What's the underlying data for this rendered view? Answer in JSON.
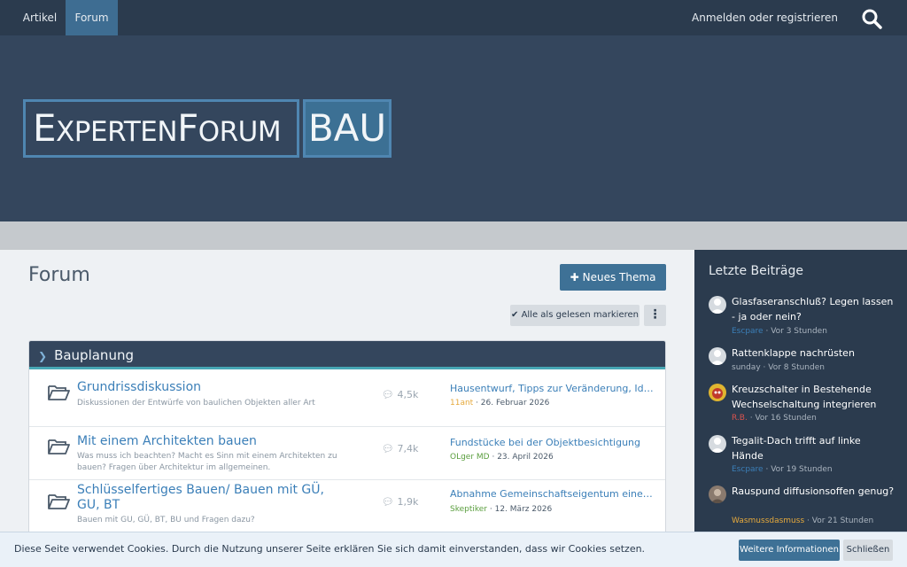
{
  "nav": {
    "tabs": [
      {
        "label": "Artikel"
      },
      {
        "label": "Forum"
      }
    ],
    "login_label": "Anmelden oder registrieren"
  },
  "logo": {
    "text_left_first": "E",
    "text_left_rest": "XPERTEN",
    "text_left_second": "F",
    "text_left_rest2": "ORUM",
    "text_right": "BAU"
  },
  "main": {
    "title": "Forum",
    "new_thread_label": "Neues Thema",
    "mark_read_label": "Alle als gelesen markieren",
    "more_label": "⋮",
    "category": {
      "title": "Bauplanung",
      "nodes": [
        {
          "title": "Grundrissdiskussion",
          "description": "Diskussionen der Entwürfe von baulichen Objekten aller Art",
          "stat": "4,5k",
          "last_title": "Hausentwurf, Tipps zur Veränderung, Ideen",
          "last_user": "11ant",
          "last_date": "26. Februar 2026"
        },
        {
          "title": "Mit einem Architekten bauen",
          "description": "Was muss ich beachten? Macht es Sinn mit einem Architekten zu bauen? Fragen über Architektur im allgemeinen.",
          "stat": "7,4k",
          "last_title": "Fundstücke bei der Objektbesichtigung",
          "last_user": "OLger MD",
          "last_date": "23. April 2026"
        },
        {
          "title": "Schlüsselfertiges Bauen/ Bauen mit GÜ, GU, BT",
          "description": "Bauen mit GU, GÜ, BT, BU und Fragen dazu?",
          "stat": "1,9k",
          "last_title": "Abnahme Gemeinschaftseigentum einer Wohnanlage",
          "last_user": "Skeptiker",
          "last_date": "12. März 2026"
        }
      ]
    }
  },
  "sidebar": {
    "title": "Letzte Beiträge",
    "posts": [
      {
        "title": "Glasfaseranschluß? Legen lassen - ja oder nein?",
        "user": "Escpare",
        "time": "Vor 3 Stunden",
        "user_color": "#3b7fb8"
      },
      {
        "title": "Rattenklappe nachrüsten",
        "user": "sunday",
        "time": "Vor 8 Stunden",
        "user_color": "#aab4bf"
      },
      {
        "title": "Kreuzschalter in Bestehende Wechselschaltung integrieren",
        "user": "R.B.",
        "time": "Vor 16 Stunden",
        "user_color": "#d9534f"
      },
      {
        "title": "Tegalit-Dach trifft auf linke Hände",
        "user": "Escpare",
        "time": "Vor 19 Stunden",
        "user_color": "#3b7fb8"
      },
      {
        "title": "Rauspund diffusionsoffen genug?",
        "user": "Wasmussdasmuss",
        "time": "Vor 21 Stunden",
        "user_color": "#e5a93c"
      }
    ]
  },
  "cookie": {
    "text": "Diese Seite verwendet Cookies. Durch die Nutzung unserer Seite erklären Sie sich damit einverstanden, dass wir Cookies setzen.",
    "info_label": "Weitere Informationen",
    "close_label": "Schließen"
  },
  "separator": " · "
}
